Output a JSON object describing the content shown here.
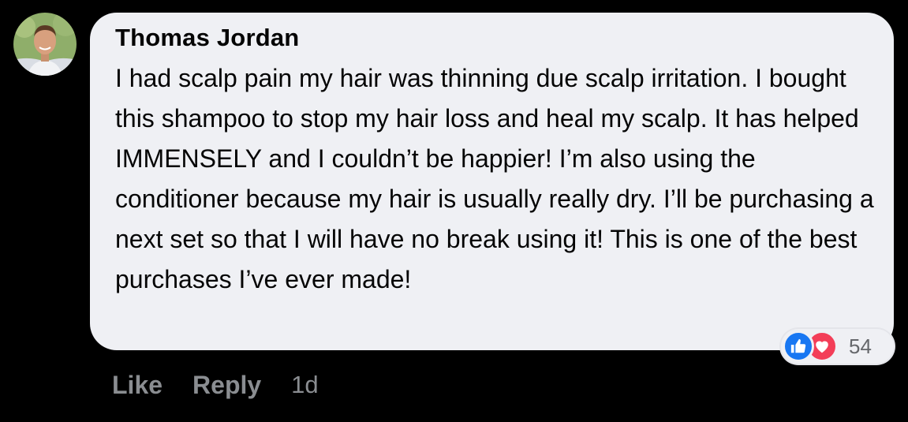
{
  "comment": {
    "author": "Thomas Jordan",
    "avatar_icon": "profile-photo",
    "text": "I had scalp pain my hair was thinning due scalp irritation. I bought this shampoo to stop my hair loss and heal my scalp. It has helped IMMENSELY and I couldn’t be happier! I’m also using the conditioner because my hair is usually really dry. I’ll be purchasing a next set so that I will have no break using it! This is one of the best purchases I’ve ever made!",
    "reactions": {
      "icons": [
        "thumbs-up-icon",
        "heart-icon"
      ],
      "count": "54",
      "like_color": "#1877f2",
      "love_color": "#f33e58"
    }
  },
  "actions": {
    "like_label": "Like",
    "reply_label": "Reply",
    "timestamp": "1d"
  },
  "colors": {
    "background": "#000000",
    "bubble": "#eff0f4",
    "action_text": "#8a8d91"
  }
}
